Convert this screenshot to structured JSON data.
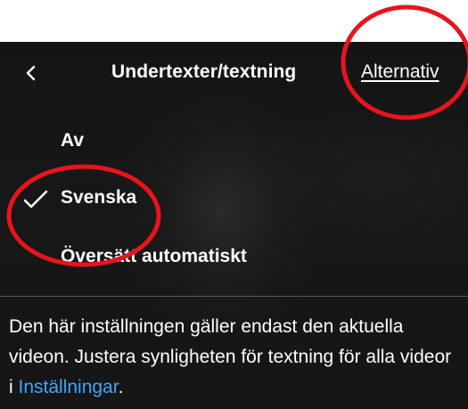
{
  "header": {
    "back_icon": "chevron-left-icon",
    "title": "Undertexter/textning",
    "options_label": "Alternativ"
  },
  "menu": {
    "items": [
      {
        "label": "Av",
        "selected": false
      },
      {
        "label": "Svenska",
        "selected": true
      },
      {
        "label": "Översätt automatiskt",
        "selected": false
      }
    ],
    "check_icon": "checkmark-icon"
  },
  "info": {
    "text_before": "Den här inställningen gäller endast den aktuella videon. Justera synligheten för textning för alla videor i ",
    "link_label": "Inställningar",
    "text_after": "."
  },
  "annotation": {
    "circle_color": "#e8141c"
  },
  "colors": {
    "link": "#3ea6ff",
    "text": "#ffffff"
  }
}
